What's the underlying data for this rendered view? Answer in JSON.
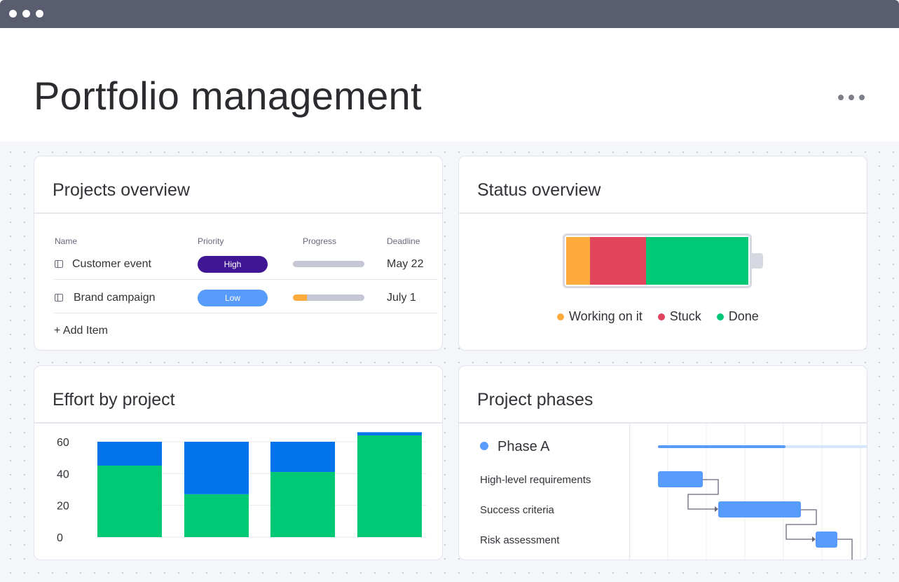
{
  "window": {
    "controls": [
      "dot",
      "dot",
      "dot"
    ]
  },
  "header": {
    "title": "Portfolio management",
    "more_icon": "more-horizontal-icon"
  },
  "projects_overview": {
    "title": "Projects overview",
    "columns": [
      "Name",
      "Priority",
      "Progress",
      "Deadline"
    ],
    "rows": [
      {
        "name": "Customer event",
        "priority": "High",
        "priority_color": "#401694",
        "progress": 0,
        "deadline": "May 22"
      },
      {
        "name": "Brand campaign",
        "priority": "Low",
        "priority_color": "#579bfc",
        "progress": 0.2,
        "deadline": "July 1"
      }
    ],
    "add_item": "+ Add Item"
  },
  "status_overview": {
    "title": "Status overview",
    "segments": [
      {
        "label": "Working on it",
        "value": 13,
        "color": "#fdab3d"
      },
      {
        "label": "Stuck",
        "value": 31,
        "color": "#e2445c"
      },
      {
        "label": "Done",
        "value": 56,
        "color": "#00c875"
      }
    ]
  },
  "effort_chart": {
    "title": "Effort by project",
    "chart_data": {
      "type": "bar",
      "stacked": true,
      "categories": [
        "",
        "",
        "",
        ""
      ],
      "series": [
        {
          "values": [
            45,
            27,
            41,
            64
          ],
          "color": "#00c875"
        },
        {
          "values": [
            15,
            33,
            19,
            2
          ],
          "color": "#0073ea"
        }
      ],
      "yticks": [
        60,
        40,
        20,
        0
      ],
      "ylim": [
        0,
        60
      ],
      "grid": true
    }
  },
  "project_phases": {
    "title": "Project phases",
    "phase": "Phase A",
    "phase_color": "#579bfc",
    "tasks": [
      "High-level requirements",
      "Success criteria",
      "Risk assessment"
    ]
  }
}
